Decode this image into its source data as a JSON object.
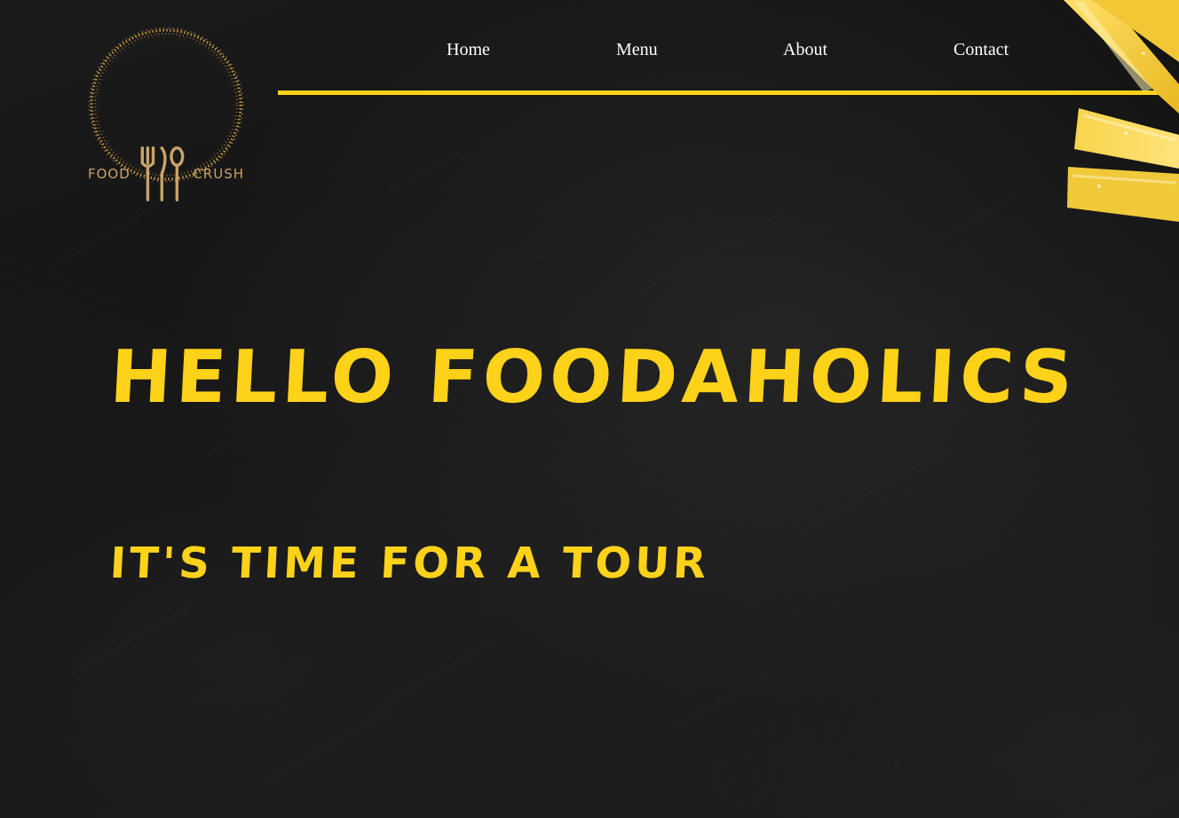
{
  "brand": {
    "logo_word_left": "FOOD",
    "logo_word_right": "CRUSH",
    "logo_icon": "fork-knife-spoon-icon",
    "logo_color": "#c9a36a"
  },
  "nav": {
    "items": [
      {
        "label": "Home"
      },
      {
        "label": "Menu"
      },
      {
        "label": "About"
      },
      {
        "label": "Contact"
      }
    ],
    "accent_color": "#ffd21a"
  },
  "hero": {
    "title": "HELLO FOODAHOLICS",
    "subtitle": "IT'S TIME FOR A TOUR",
    "text_color": "#ffd21a"
  },
  "background": {
    "color": "#151515",
    "decoration": "pasta-strips"
  }
}
